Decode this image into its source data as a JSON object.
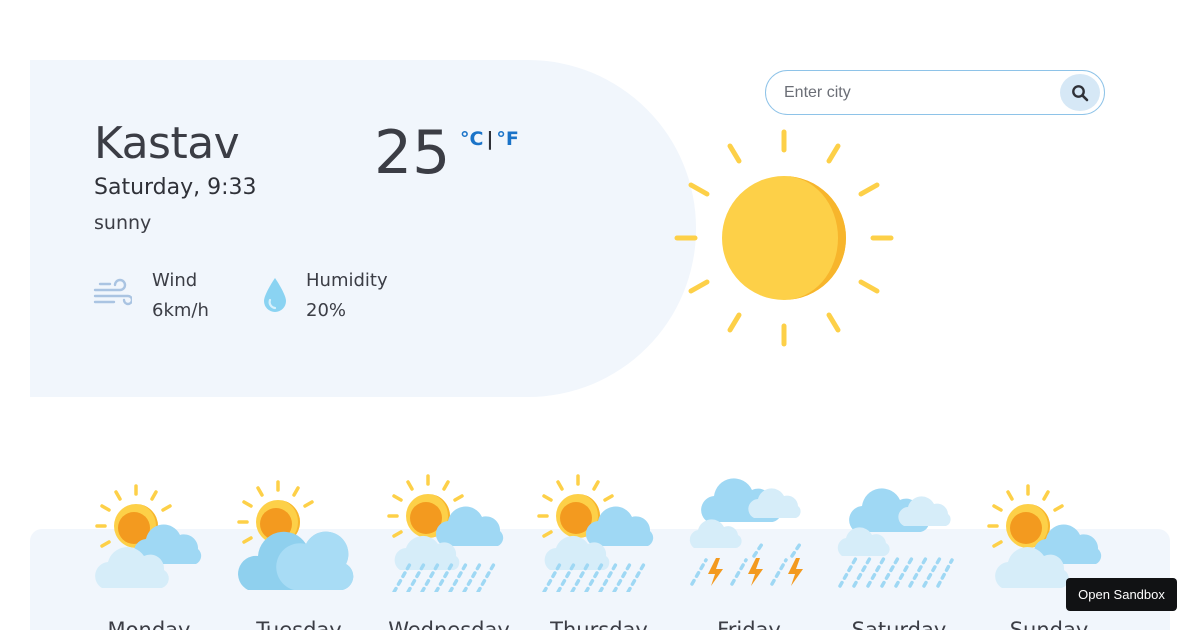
{
  "current": {
    "city": "Kastav",
    "datetime": "Saturday, 9:33",
    "condition": "sunny",
    "temperature": "25",
    "unit_celsius": "°C",
    "unit_separator": "|",
    "unit_fahrenheit": "°F",
    "icon": "sun-icon"
  },
  "details": {
    "wind": {
      "label": "Wind",
      "value": "6km/h",
      "icon": "wind-icon"
    },
    "humidity": {
      "label": "Humidity",
      "value": "20%",
      "icon": "water-drop-icon"
    }
  },
  "search": {
    "placeholder": "Enter city",
    "value": "",
    "icon": "search-icon"
  },
  "forecast": [
    {
      "day": "Monday",
      "icon": "partly-cloudy-icon"
    },
    {
      "day": "Tuesday",
      "icon": "cloudy-sun-icon"
    },
    {
      "day": "Wednesday",
      "icon": "sun-rain-icon"
    },
    {
      "day": "Thursday",
      "icon": "sun-rain-icon"
    },
    {
      "day": "Friday",
      "icon": "thunderstorm-icon"
    },
    {
      "day": "Saturday",
      "icon": "rain-icon"
    },
    {
      "day": "Sunday",
      "icon": "partly-cloudy-icon"
    }
  ],
  "sandbox_button": {
    "label": "Open Sandbox"
  },
  "colors": {
    "accent": "#1a73c8",
    "card_background": "#f1f6fc",
    "sun": "#fdd048",
    "sun_shade": "#f7b52c",
    "cloud": "#9fd8f4"
  }
}
